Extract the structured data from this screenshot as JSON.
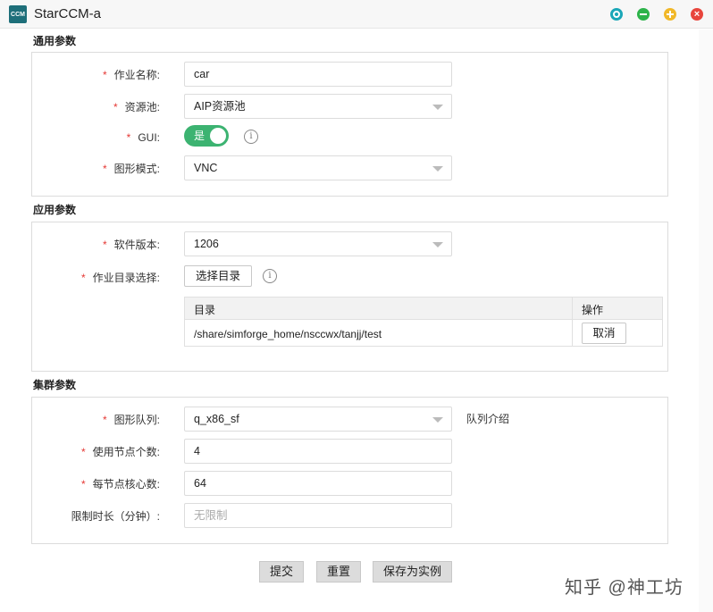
{
  "window": {
    "icon_text": "CCM",
    "title": "StarCCM-a"
  },
  "sections": {
    "general": "通用参数",
    "application": "应用参数",
    "cluster": "集群参数"
  },
  "required_mark": "*",
  "general": {
    "job_name_label": "作业名称:",
    "job_name_value": "car",
    "pool_label": "资源池:",
    "pool_value": "AIP资源池",
    "gui_label": "GUI:",
    "gui_toggle_text": "是",
    "gui_toggle_on": true,
    "graphics_mode_label": "图形模式:",
    "graphics_mode_value": "VNC"
  },
  "application": {
    "version_label": "软件版本:",
    "version_value": "1206",
    "workdir_label": "作业目录选择:",
    "select_dir_button": "选择目录",
    "table": {
      "headers": [
        "目录",
        "操作"
      ],
      "rows": [
        {
          "path": "/share/simforge_home/nsccwx/tanjj/test",
          "action": "取消"
        }
      ]
    }
  },
  "cluster": {
    "queue_label": "图形队列:",
    "queue_value": "q_x86_sf",
    "queue_intro_link": "队列介绍",
    "nodes_label": "使用节点个数:",
    "nodes_value": "4",
    "cores_label": "每节点核心数:",
    "cores_value": "64",
    "time_limit_label": "限制时长（分钟）:",
    "time_limit_placeholder": "无限制"
  },
  "footer": {
    "submit": "提交",
    "reset": "重置",
    "save_instance": "保存为实例"
  },
  "watermark": "知乎 @神工坊",
  "icons": {
    "info": "info-icon",
    "dropdown": "chevron-down-icon"
  }
}
